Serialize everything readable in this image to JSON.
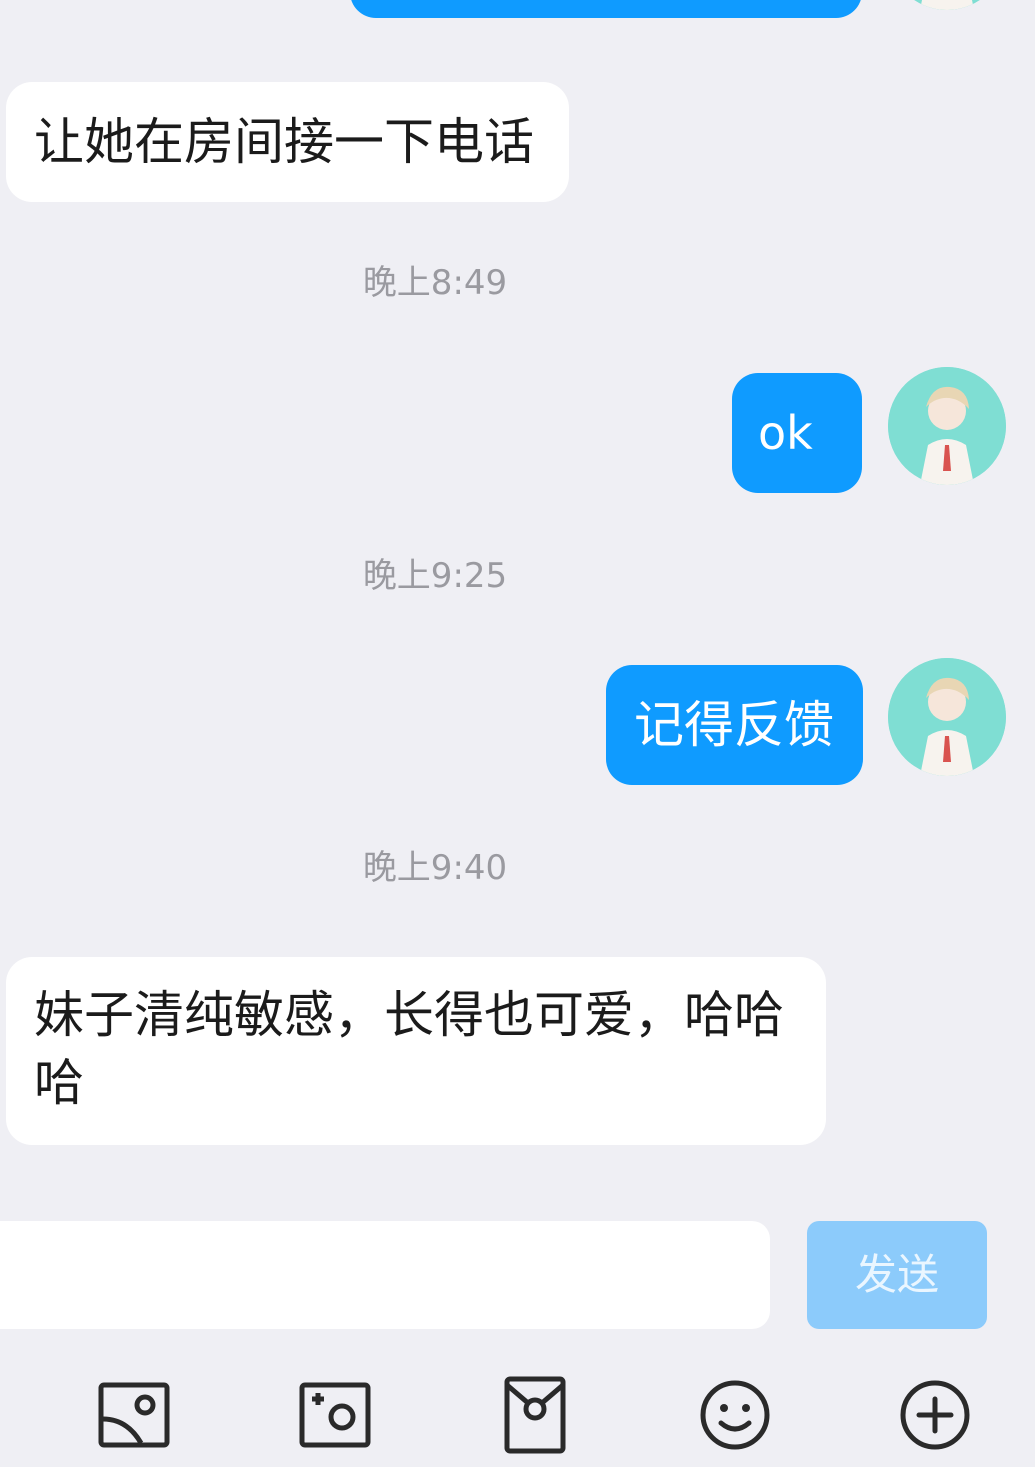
{
  "messages": [
    {
      "side": "in",
      "text": "让她在房间接一下电话"
    },
    {
      "time": "晚上8:49"
    },
    {
      "side": "out",
      "text": "ok"
    },
    {
      "time": "晚上9:25"
    },
    {
      "side": "out",
      "text": "记得反馈"
    },
    {
      "time": "晚上9:40"
    },
    {
      "side": "in",
      "text": "妹子清纯敏感，长得也可爱，哈哈哈"
    }
  ],
  "composer": {
    "input_value": "",
    "send_label": "发送"
  },
  "toolbar": [
    {
      "icon": "image-icon"
    },
    {
      "icon": "camera-icon"
    },
    {
      "icon": "red-packet-icon"
    },
    {
      "icon": "emoji-icon"
    },
    {
      "icon": "plus-icon"
    }
  ],
  "colors": {
    "background": "#efeff4",
    "outgoing_bubble": "#0f9bff",
    "incoming_bubble": "#ffffff",
    "send_button_disabled": "#8ccbfb"
  }
}
